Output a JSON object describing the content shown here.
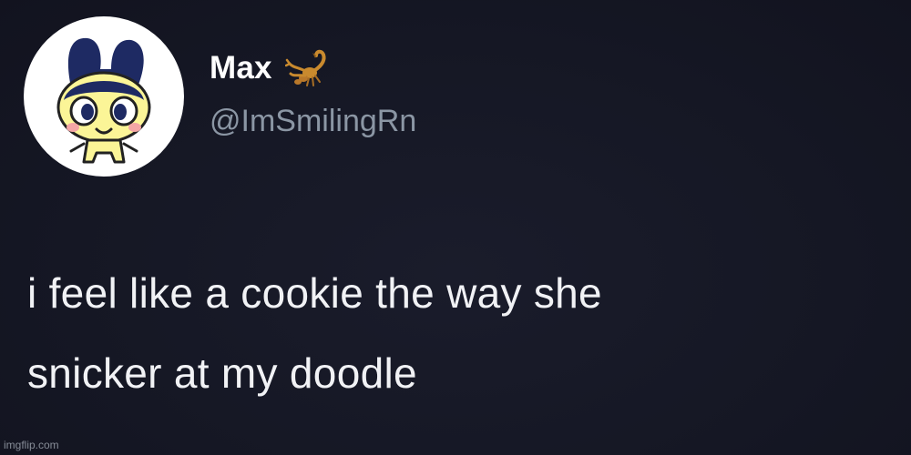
{
  "author": {
    "display_name": "Max",
    "handle": "@ImSmilingRn",
    "avatar_icon": "tamagotchi-character-avatar",
    "name_emoji": "scorpion-icon"
  },
  "tweet": {
    "text_line1": "i feel like a cookie the way she",
    "text_line2": "snicker at my doodle"
  },
  "watermark": "imgflip.com",
  "colors": {
    "background": "#161826",
    "name": "#ffffff",
    "handle": "#8b96a4",
    "text": "#f1f2f5"
  }
}
